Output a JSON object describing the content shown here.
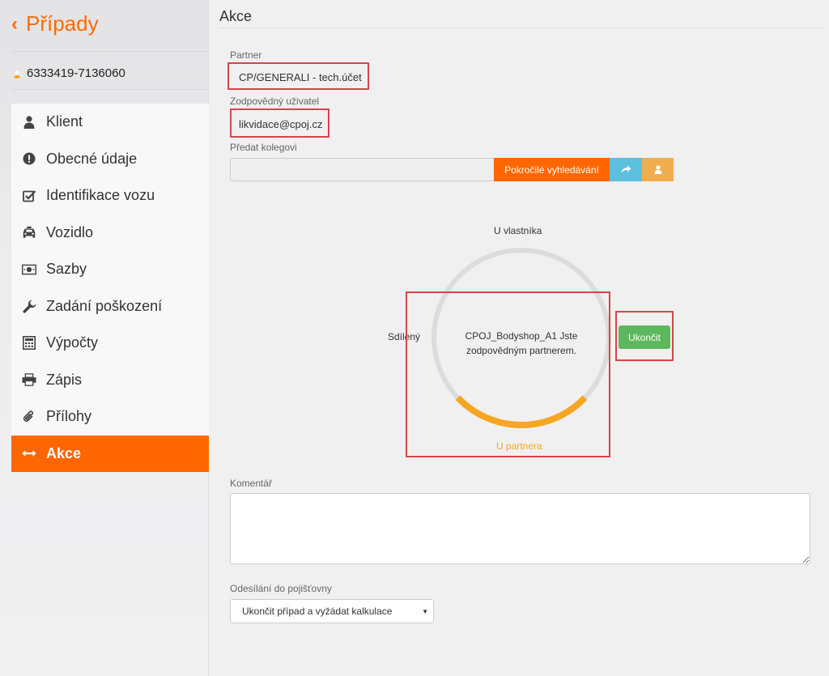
{
  "sidebar": {
    "back_title": "Případy",
    "case_number": "6333419-7136060",
    "items": [
      {
        "label": "Klient",
        "icon": "user-icon"
      },
      {
        "label": "Obecné údaje",
        "icon": "exclamation-circle-icon"
      },
      {
        "label": "Identifikace vozu",
        "icon": "checkbox-icon"
      },
      {
        "label": "Vozidlo",
        "icon": "car-icon"
      },
      {
        "label": "Sazby",
        "icon": "money-icon"
      },
      {
        "label": "Zadání poškození",
        "icon": "wrench-icon"
      },
      {
        "label": "Výpočty",
        "icon": "calculator-icon"
      },
      {
        "label": "Zápis",
        "icon": "printer-icon"
      },
      {
        "label": "Přílohy",
        "icon": "paperclip-icon"
      },
      {
        "label": "Akce",
        "icon": "arrows-horizontal-icon",
        "active": true
      }
    ]
  },
  "main": {
    "title": "Akce",
    "partner_label": "Partner",
    "partner_value": "CP/GENERALI - tech.účet",
    "user_label": "Zodpovědný uživatel",
    "user_value": "likvidace@cpoj.cz",
    "transfer_label": "Předat kolegovi",
    "transfer_value": "",
    "advanced_search_button": "Pokročilé vyhledávání",
    "state_top": "U vlastníka",
    "state_left": "Sdílený",
    "state_bottom": "U partnera",
    "circle_text": "CPOJ_Bodyshop_A1 Jste zodpovědným partnerem.",
    "finish_button": "Ukončit",
    "comment_label": "Komentář",
    "comment_value": "",
    "send_label": "Odesílání do pojišťovny",
    "send_selected": "Ukončit případ a vyžádat kalkulace"
  },
  "colors": {
    "accent": "#ff6600",
    "progress": "#f5a623",
    "success": "#5cb85c",
    "info": "#5bc0de",
    "warning": "#f0ad4e",
    "highlight": "#d9434a"
  }
}
